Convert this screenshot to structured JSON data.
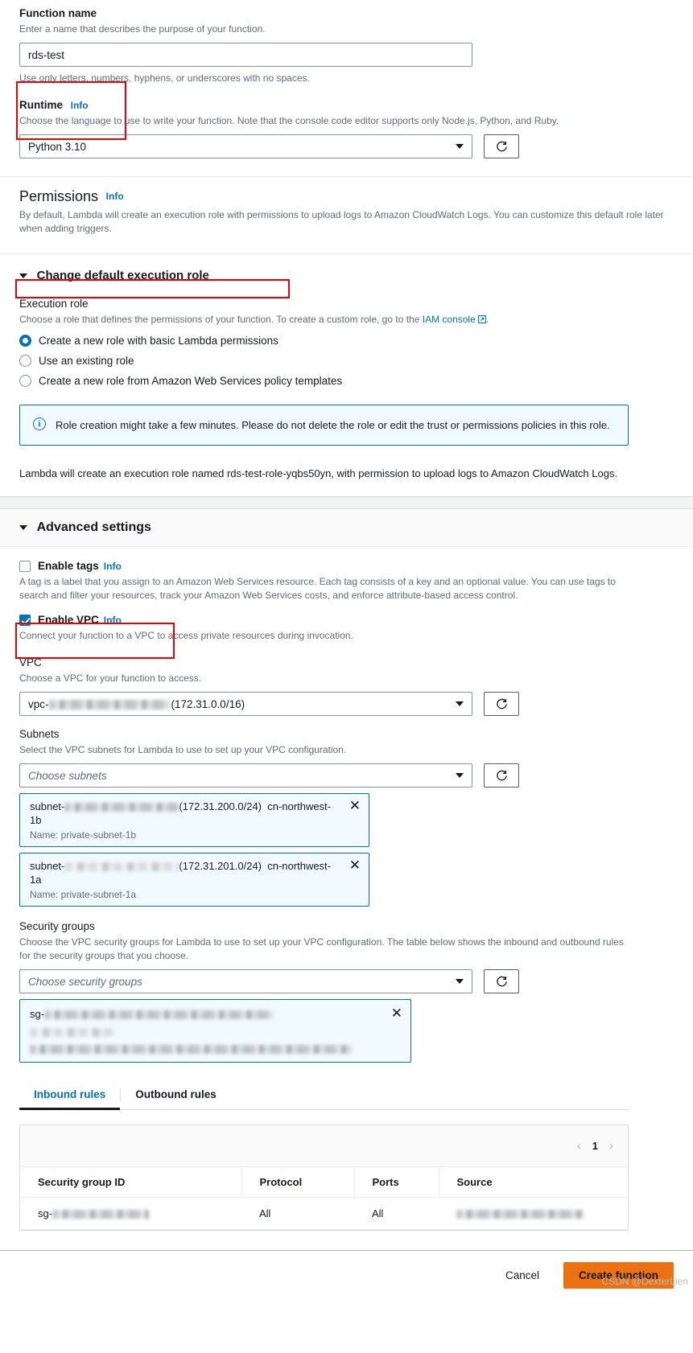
{
  "function_name": {
    "label": "Function name",
    "description": "Enter a name that describes the purpose of your function.",
    "value": "rds-test",
    "constraint": "Use only letters, numbers, hyphens, or underscores with no spaces."
  },
  "runtime": {
    "label": "Runtime",
    "info": "Info",
    "description": "Choose the language to use to write your function. Note that the console code editor supports only Node.js, Python, and Ruby.",
    "value": "Python 3.10",
    "refresh_icon": "refresh-icon"
  },
  "permissions": {
    "title": "Permissions",
    "info": "Info",
    "description": "By default, Lambda will create an execution role with permissions to upload logs to Amazon CloudWatch Logs. You can customize this default role later when adding triggers.",
    "change_role_toggle": "Change default execution role",
    "execution_role_label": "Execution role",
    "execution_role_desc_before": "Choose a role that defines the permissions of your function. To create a custom role, go to the ",
    "execution_role_link": "IAM console",
    "execution_role_desc_after": ".",
    "options": [
      {
        "label": "Create a new role with basic Lambda permissions",
        "selected": true
      },
      {
        "label": "Use an existing role",
        "selected": false
      },
      {
        "label": "Create a new role from Amazon Web Services policy templates",
        "selected": false
      }
    ],
    "alert": "Role creation might take a few minutes. Please do not delete the role or edit the trust or permissions policies in this role.",
    "role_note": "Lambda will create an execution role named rds-test-role-yqbs50yn, with permission to upload logs to Amazon CloudWatch Logs."
  },
  "advanced": {
    "title": "Advanced settings",
    "enable_tags": {
      "label": "Enable tags",
      "info": "Info",
      "checked": false,
      "description": "A tag is a label that you assign to an Amazon Web Services resource. Each tag consists of a key and an optional value. You can use tags to search and filter your resources, track your Amazon Web Services costs, and enforce attribute-based access control."
    },
    "enable_vpc": {
      "label": "Enable VPC",
      "info": "Info",
      "checked": true,
      "description": "Connect your function to a VPC to access private resources during invocation."
    },
    "vpc": {
      "label": "VPC",
      "description": "Choose a VPC for your function to access.",
      "value_prefix": "vpc-",
      "value_suffix": "(172.31.0.0/16)"
    },
    "subnets": {
      "label": "Subnets",
      "description": "Select the VPC subnets for Lambda to use to set up your VPC configuration.",
      "placeholder": "Choose subnets",
      "selected": [
        {
          "prefix": "subnet-",
          "cidr": "(172.31.200.0/24)",
          "az": "cn-northwest-1b",
          "name": "Name: private-subnet-1b"
        },
        {
          "prefix": "subnet-",
          "cidr": "(172.31.201.0/24)",
          "az": "cn-northwest-1a",
          "name": "Name: private-subnet-1a"
        }
      ]
    },
    "security_groups": {
      "label": "Security groups",
      "description": "Choose the VPC security groups for Lambda to use to set up your VPC configuration. The table below shows the inbound and outbound rules for the security groups that you choose.",
      "placeholder": "Choose security groups",
      "selected": [
        {
          "prefix": "sg-"
        }
      ]
    },
    "rules_tabs": [
      {
        "label": "Inbound rules",
        "active": true
      },
      {
        "label": "Outbound rules",
        "active": false
      }
    ],
    "rules_table": {
      "page": "1",
      "columns": [
        "Security group ID",
        "Protocol",
        "Ports",
        "Source"
      ],
      "rows": [
        {
          "security_group_id_prefix": "sg-",
          "protocol": "All",
          "ports": "All",
          "source_redacted": true
        }
      ]
    }
  },
  "footer": {
    "cancel": "Cancel",
    "create": "Create function"
  },
  "watermark": "CSDN @DexterLien",
  "colors": {
    "accent_blue": "#0073bb",
    "primary_orange": "#ec7211",
    "highlight_red": "#ee0000",
    "alert_bg": "#f1faff"
  }
}
